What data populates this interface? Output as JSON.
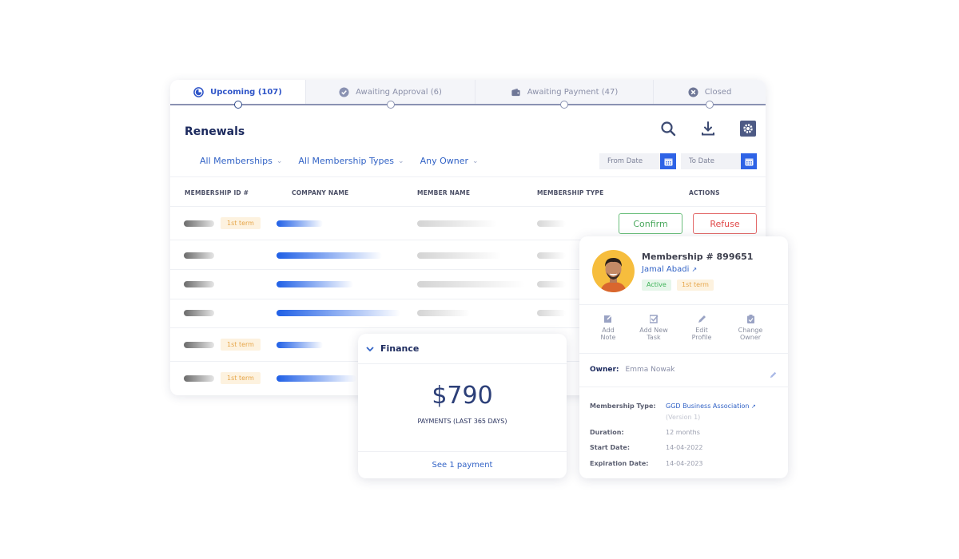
{
  "tabs": [
    {
      "label": "Upcoming (107)",
      "icon": "progress-icon",
      "active": true
    },
    {
      "label": "Awaiting Approval (6)",
      "icon": "check-circle-icon",
      "active": false
    },
    {
      "label": "Awaiting Payment (47)",
      "icon": "wallet-icon",
      "active": false
    },
    {
      "label": "Closed",
      "icon": "x-circle-icon",
      "active": false
    }
  ],
  "header": {
    "title": "Renewals"
  },
  "toolbar": {
    "search": "search-icon",
    "download": "download-icon",
    "settings": "gear-icon"
  },
  "filters": [
    {
      "label": "All Memberships"
    },
    {
      "label": "All Membership Types"
    },
    {
      "label": "Any Owner"
    }
  ],
  "dates": {
    "from_placeholder": "From Date",
    "to_placeholder": "To Date"
  },
  "table": {
    "columns": [
      "MEMBERSHIP ID #",
      "COMPANY NAME",
      "MEMBER NAME",
      "MEMBERSHIP TYPE",
      "ACTIONS"
    ],
    "term_label": "1st term",
    "confirm_label": "Confirm",
    "refuse_label": "Refuse"
  },
  "finance": {
    "title": "Finance",
    "amount": "$790",
    "caption": "PAYMENTS (LAST 365 DAYS)",
    "link": "See 1 payment"
  },
  "profile": {
    "title": "Membership # 899651",
    "name": "Jamal Abadi",
    "status": "Active",
    "term": "1st term",
    "actions": [
      {
        "line1": "Add",
        "line2": "Note"
      },
      {
        "line1": "Add New",
        "line2": "Task"
      },
      {
        "line1": "Edit",
        "line2": "Profile"
      },
      {
        "line1": "Change",
        "line2": "Owner"
      }
    ],
    "owner_label": "Owner:",
    "owner_value": "Emma Nowak",
    "details": {
      "type_label": "Membership Type:",
      "type_value": "GGD Business Association",
      "type_version": "(Version 1)",
      "duration_label": "Duration:",
      "duration_value": "12 months",
      "start_label": "Start Date:",
      "start_value": "14-04-2022",
      "expiration_label": "Expiration Date:",
      "expiration_value": "14-04-2023"
    }
  },
  "colors": {
    "accent": "#2e63e6",
    "title": "#1c2a5e",
    "confirm": "#4aa85d",
    "refuse": "#e04646",
    "term": "#e6a64a",
    "active": "#3fb35a"
  }
}
